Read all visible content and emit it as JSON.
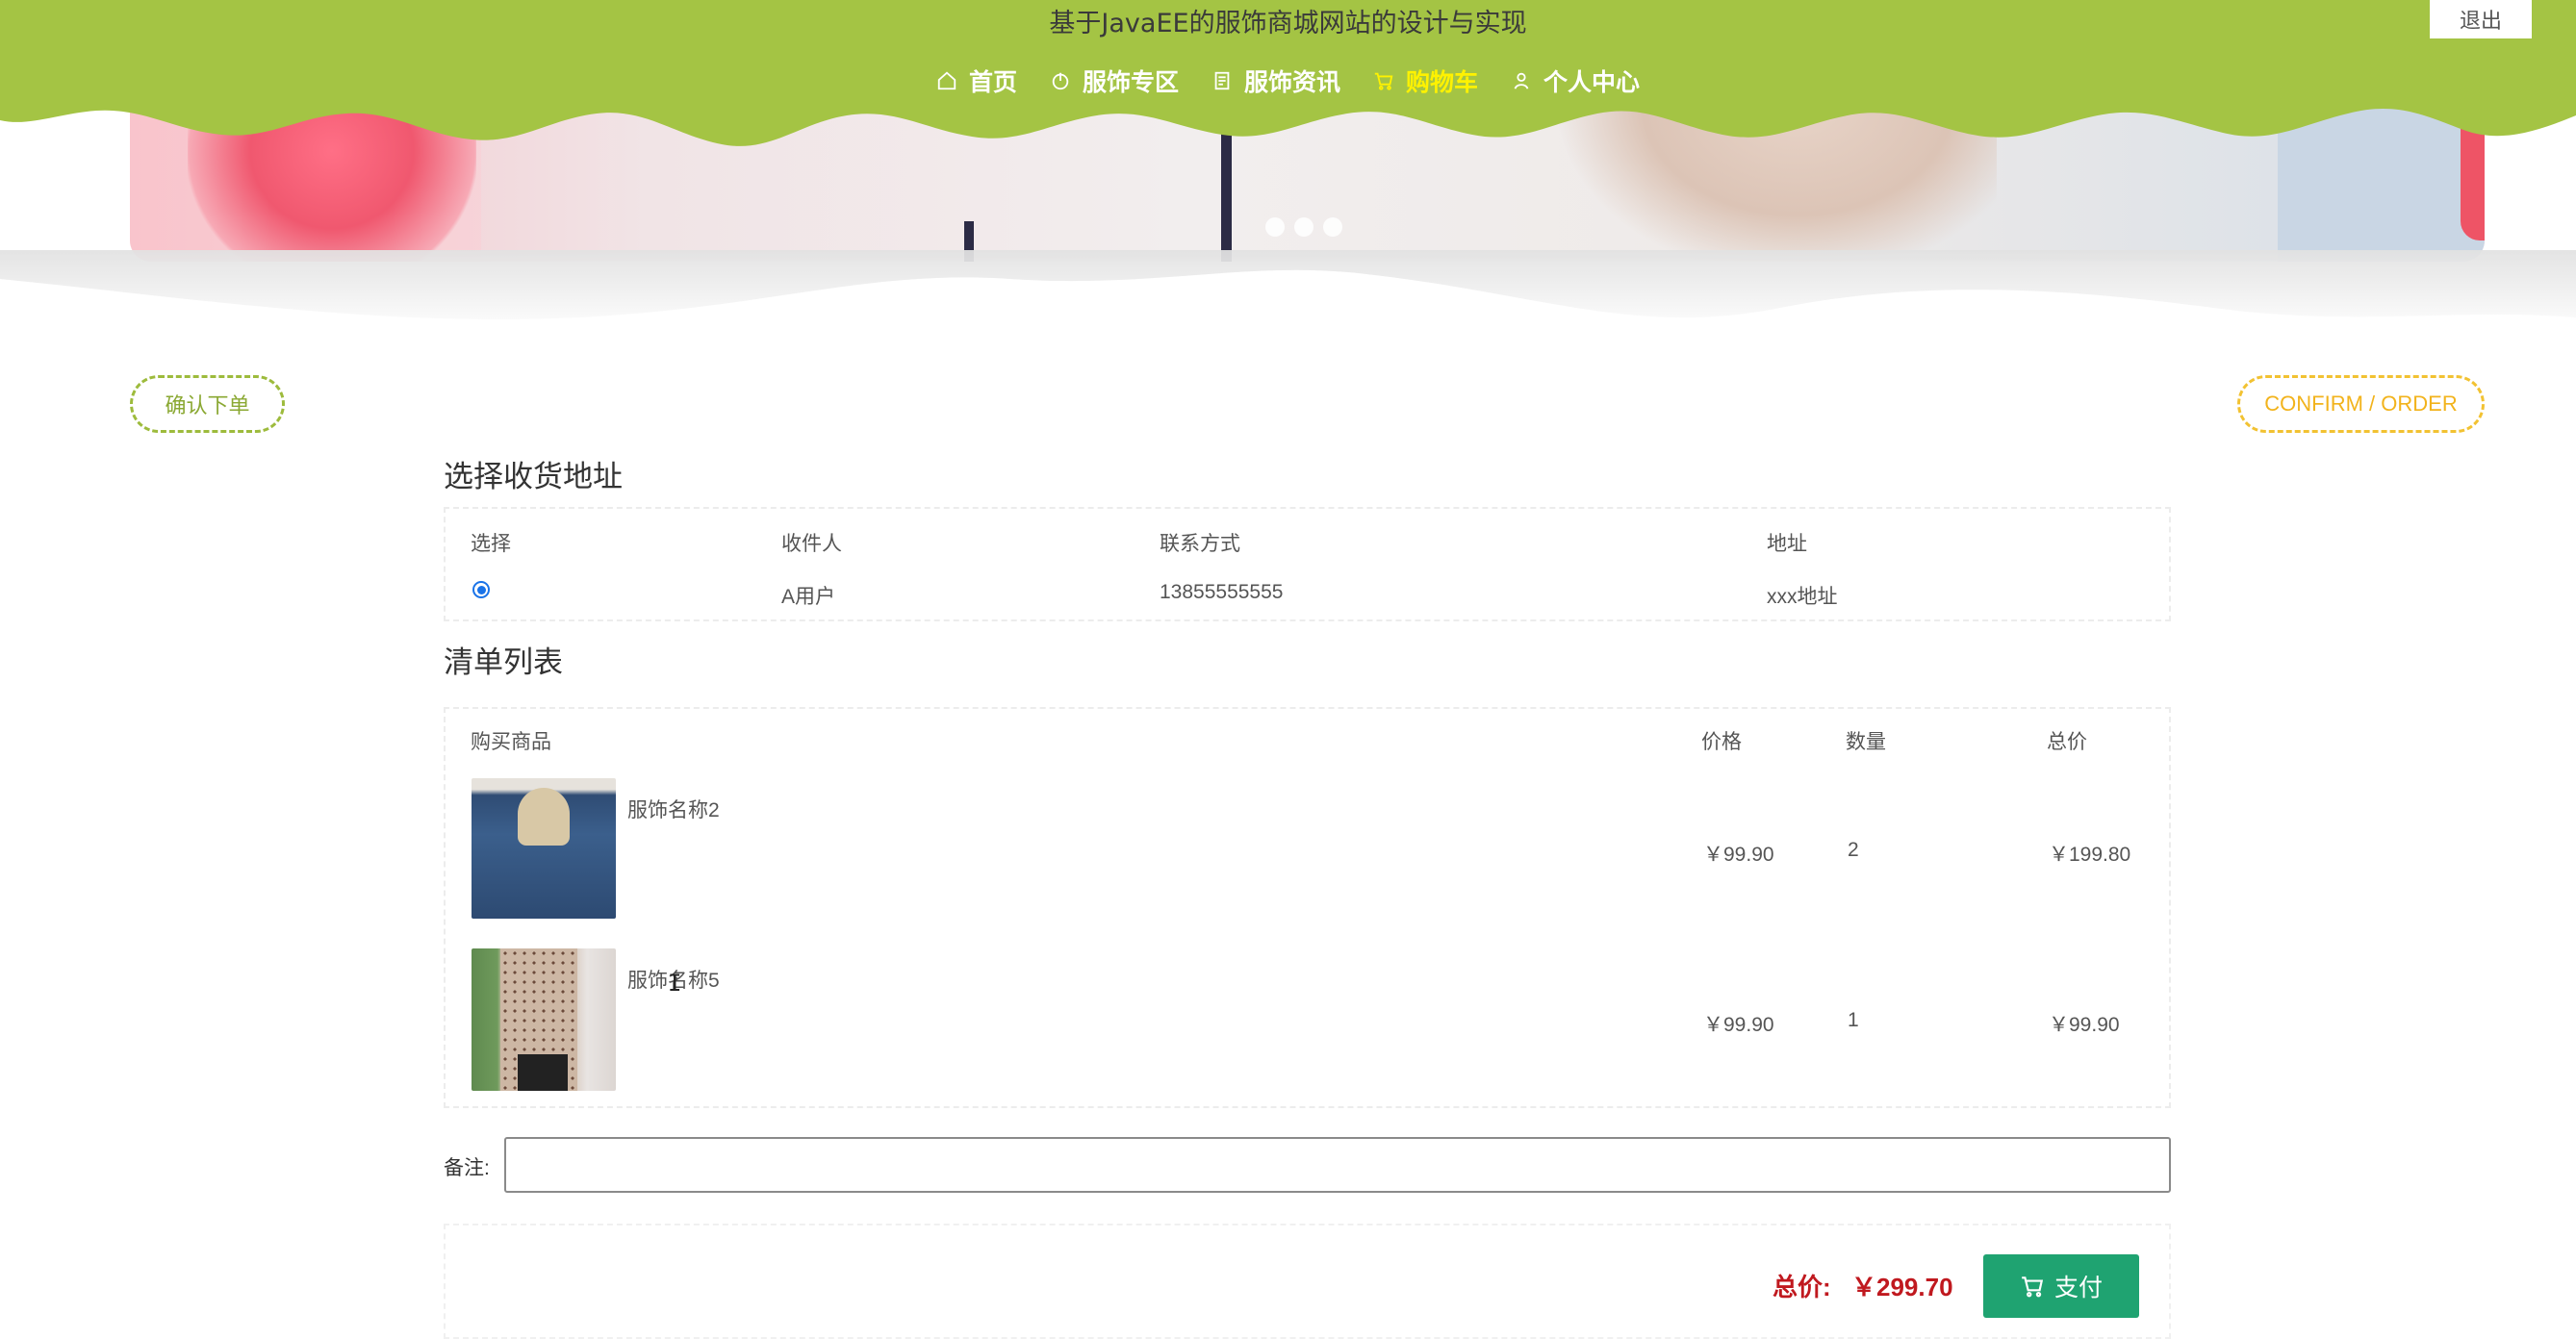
{
  "header": {
    "site_title": "基于JavaEE的服饰商城网站的设计与实现",
    "logout_label": "退出",
    "nav": [
      {
        "label": "首页",
        "icon": "home-icon"
      },
      {
        "label": "服饰专区",
        "icon": "power-icon"
      },
      {
        "label": "服饰资讯",
        "icon": "news-icon"
      },
      {
        "label": "购物车",
        "icon": "cart-icon",
        "active": true
      },
      {
        "label": "个人中心",
        "icon": "user-icon"
      }
    ],
    "accent_color": "#a4c444",
    "active_nav_color": "#fff200"
  },
  "page_titles": {
    "left": "确认下单",
    "right": "CONFIRM / ORDER"
  },
  "address": {
    "title": "选择收货地址",
    "headers": [
      "选择",
      "收件人",
      "联系方式",
      "地址"
    ],
    "rows": [
      {
        "selected": true,
        "recipient": "A用户",
        "phone": "13855555555",
        "address": "xxx地址"
      }
    ]
  },
  "order_list": {
    "title": "清单列表",
    "headers": [
      "购买商品",
      "价格",
      "数量",
      "总价"
    ],
    "rows": [
      {
        "name": "服饰名称2",
        "price": "￥99.90",
        "qty": "2",
        "subtotal": "￥199.80"
      },
      {
        "name": "服饰名称5",
        "price": "￥99.90",
        "qty": "1",
        "subtotal": "￥99.90"
      }
    ]
  },
  "remark": {
    "label": "备注:",
    "value": ""
  },
  "summary": {
    "total_label": "总价:",
    "total_value": "￥299.70",
    "pay_label": "支付"
  }
}
